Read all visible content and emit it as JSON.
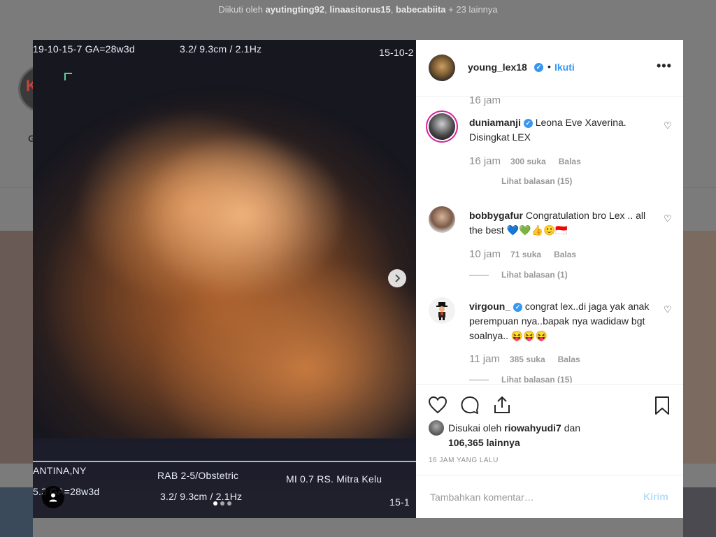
{
  "background": {
    "followed_prefix": "Diikuti oleh",
    "followers": [
      "ayutingting92",
      "linaasitorus15",
      "babecabiita"
    ],
    "followed_suffix": "+ 23 lainnya",
    "followed_sep": ",",
    "profile_initial": "K",
    "profile_name_fragment": "G"
  },
  "photo": {
    "top_left_text": "19-10-15-7  GA=28w3d",
    "top_mid_text": "3.2/ 9.3cm / 2.1Hz",
    "top_right_text": "15-10-2",
    "bottom_left_text": "ANTINA,NY",
    "bottom_left_text2": "5.3 GA=28w3d",
    "bottom_mid_text": "RAB 2-5/Obstetric",
    "bottom_mid_text2": "3.2/ 9.3cm / 2.1Hz",
    "bottom_right_text": "MI  0.7   RS. Mitra Kelu",
    "bottom_right_text2": "15-1",
    "carousel_total": 3,
    "carousel_active": 1,
    "next_icon": "chevron-right-icon",
    "tag_icon": "user-tag-icon"
  },
  "post": {
    "username": "young_lex18",
    "verified": true,
    "dot": "•",
    "follow_label": "Ikuti",
    "more_label": "•••",
    "previous_time": "16 jam"
  },
  "comments": [
    {
      "username": "duniamanji",
      "verified": true,
      "text": "Leona Eve Xaverina. Disingkat LEX",
      "time": "16 jam",
      "likes": "300 suka",
      "reply_label": "Balas",
      "view_replies": "Lihat balasan (15)"
    },
    {
      "username": "bobbygafur",
      "verified": false,
      "text": "Congratulation bro Lex .. all the best 💙💚👍🙂🇮🇩",
      "time": "10 jam",
      "likes": "71 suka",
      "reply_label": "Balas",
      "view_replies": "Lihat balasan (1)"
    },
    {
      "username": "virgoun_",
      "verified": true,
      "text": "congrat lex..di jaga yak anak perempuan nya..bapak nya wadidaw bgt soalnya.. 😝😝😝",
      "time": "11 jam",
      "likes": "385 suka",
      "reply_label": "Balas",
      "view_replies": "Lihat balasan (15)"
    }
  ],
  "actions": {
    "icons": [
      "heart-icon",
      "comment-icon",
      "share-icon",
      "bookmark-icon"
    ],
    "liked_by_prefix": "Disukai oleh",
    "liked_by_user": "riowahyudi7",
    "liked_by_and": "dan",
    "liked_by_count": "106,365 lainnya",
    "timestamp": "16 JAM YANG LALU"
  },
  "add_comment": {
    "placeholder": "Tambahkan komentar…",
    "post_label": "Kirim"
  },
  "colors": {
    "accent": "#3897f0",
    "post_disabled": "#b2dffc",
    "text": "#262626",
    "muted": "#8e8e8e"
  }
}
